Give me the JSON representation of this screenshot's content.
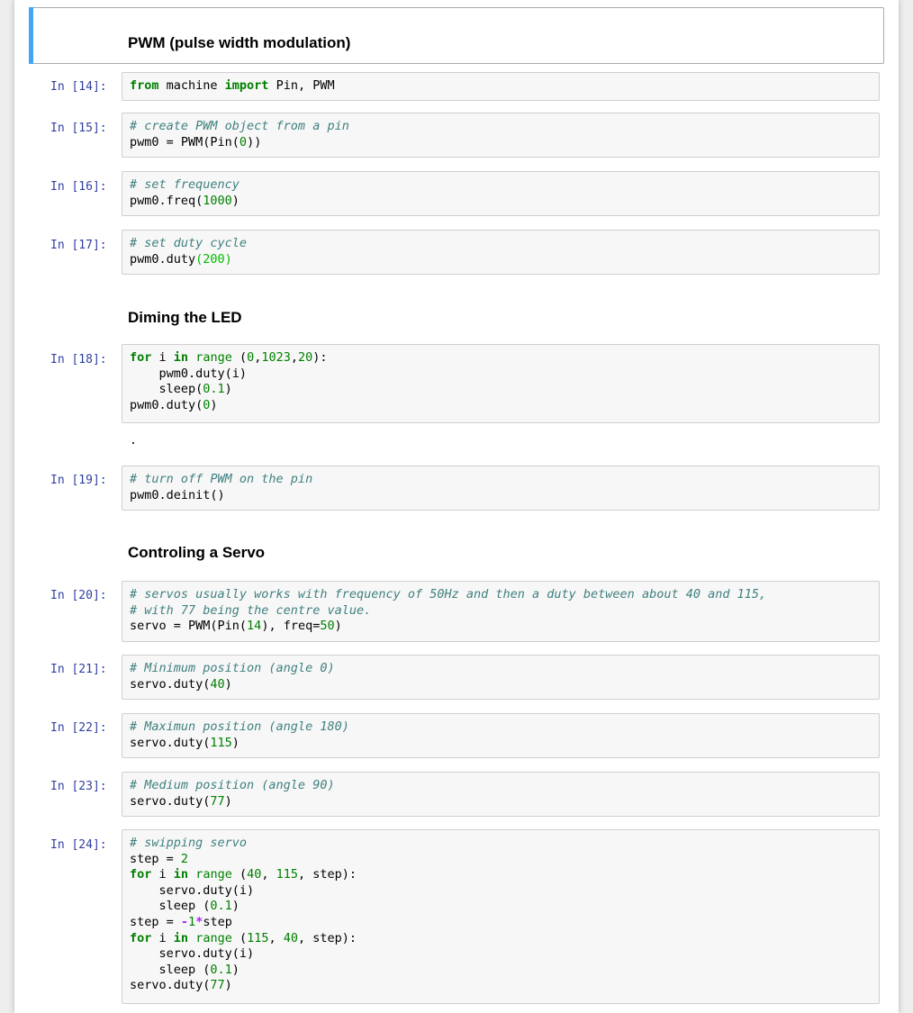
{
  "headings": {
    "pwm": "PWM (pulse width modulation)",
    "dimming": "Diming the LED",
    "servo": "Controling a Servo"
  },
  "output": {
    "cell18": "."
  },
  "cells": [
    {
      "prompt": "In [14]:",
      "lines": [
        [
          {
            "t": "from",
            "c": "kw"
          },
          {
            "t": " machine "
          },
          {
            "t": "import",
            "c": "kw"
          },
          {
            "t": " Pin, PWM"
          }
        ]
      ]
    },
    {
      "prompt": "In [15]:",
      "lines": [
        [
          {
            "t": "# create PWM object from a pin",
            "c": "cm"
          }
        ],
        [
          {
            "t": "pwm0 = PWM(Pin("
          },
          {
            "t": "0",
            "c": "num"
          },
          {
            "t": "))"
          }
        ]
      ]
    },
    {
      "prompt": "In [16]:",
      "lines": [
        [
          {
            "t": "# set frequency",
            "c": "cm"
          }
        ],
        [
          {
            "t": "pwm0.freq("
          },
          {
            "t": "1000",
            "c": "num"
          },
          {
            "t": ")"
          }
        ]
      ]
    },
    {
      "prompt": "In [17]:",
      "lines": [
        [
          {
            "t": "# set duty cycle",
            "c": "cm"
          }
        ],
        [
          {
            "t": "pwm0.duty"
          },
          {
            "t": "(200)",
            "c": "hl"
          }
        ]
      ]
    },
    {
      "prompt": "In [18]:",
      "lines": [
        [
          {
            "t": "for",
            "c": "kw"
          },
          {
            "t": " i "
          },
          {
            "t": "in",
            "c": "kw"
          },
          {
            "t": " "
          },
          {
            "t": "range",
            "c": "bi"
          },
          {
            "t": " ("
          },
          {
            "t": "0",
            "c": "num"
          },
          {
            "t": ","
          },
          {
            "t": "1023",
            "c": "num"
          },
          {
            "t": ","
          },
          {
            "t": "20",
            "c": "num"
          },
          {
            "t": "):"
          }
        ],
        [
          {
            "t": "    pwm0.duty(i)"
          }
        ],
        [
          {
            "t": "    sleep("
          },
          {
            "t": "0.1",
            "c": "num"
          },
          {
            "t": ")"
          }
        ],
        [
          {
            "t": "pwm0.duty("
          },
          {
            "t": "0",
            "c": "num"
          },
          {
            "t": ")"
          }
        ]
      ]
    },
    {
      "prompt": "In [19]:",
      "lines": [
        [
          {
            "t": "# turn off PWM on the pin",
            "c": "cm"
          }
        ],
        [
          {
            "t": "pwm0.deinit()"
          }
        ]
      ]
    },
    {
      "prompt": "In [20]:",
      "lines": [
        [
          {
            "t": "# servos usually works with frequency of 50Hz and then a duty between about 40 and 115,",
            "c": "cm"
          }
        ],
        [
          {
            "t": "# with 77 being the centre value.",
            "c": "cm"
          }
        ],
        [
          {
            "t": "servo = PWM(Pin("
          },
          {
            "t": "14",
            "c": "num"
          },
          {
            "t": "), freq="
          },
          {
            "t": "50",
            "c": "num"
          },
          {
            "t": ")"
          }
        ]
      ]
    },
    {
      "prompt": "In [21]:",
      "lines": [
        [
          {
            "t": "# Minimum position (angle 0)",
            "c": "cm"
          }
        ],
        [
          {
            "t": "servo.duty("
          },
          {
            "t": "40",
            "c": "num"
          },
          {
            "t": ")"
          }
        ]
      ]
    },
    {
      "prompt": "In [22]:",
      "lines": [
        [
          {
            "t": "# Maximun position (angle 180)",
            "c": "cm"
          }
        ],
        [
          {
            "t": "servo.duty("
          },
          {
            "t": "115",
            "c": "num"
          },
          {
            "t": ")"
          }
        ]
      ]
    },
    {
      "prompt": "In [23]:",
      "lines": [
        [
          {
            "t": "# Medium position (angle 90)",
            "c": "cm"
          }
        ],
        [
          {
            "t": "servo.duty("
          },
          {
            "t": "77",
            "c": "num"
          },
          {
            "t": ")"
          }
        ]
      ]
    },
    {
      "prompt": "In [24]:",
      "lines": [
        [
          {
            "t": "# swipping servo",
            "c": "cm"
          }
        ],
        [
          {
            "t": "step = "
          },
          {
            "t": "2",
            "c": "num"
          }
        ],
        [
          {
            "t": "for",
            "c": "kw"
          },
          {
            "t": " i "
          },
          {
            "t": "in",
            "c": "kw"
          },
          {
            "t": " "
          },
          {
            "t": "range",
            "c": "bi"
          },
          {
            "t": " ("
          },
          {
            "t": "40",
            "c": "num"
          },
          {
            "t": ", "
          },
          {
            "t": "115",
            "c": "num"
          },
          {
            "t": ", step):"
          }
        ],
        [
          {
            "t": "    servo.duty(i)"
          }
        ],
        [
          {
            "t": "    sleep ("
          },
          {
            "t": "0.1",
            "c": "num"
          },
          {
            "t": ")"
          }
        ],
        [
          {
            "t": "step = "
          },
          {
            "t": "-",
            "c": "op"
          },
          {
            "t": "1",
            "c": "num"
          },
          {
            "t": "*",
            "c": "op"
          },
          {
            "t": "step"
          }
        ],
        [
          {
            "t": "for",
            "c": "kw"
          },
          {
            "t": " i "
          },
          {
            "t": "in",
            "c": "kw"
          },
          {
            "t": " "
          },
          {
            "t": "range",
            "c": "bi"
          },
          {
            "t": " ("
          },
          {
            "t": "115",
            "c": "num"
          },
          {
            "t": ", "
          },
          {
            "t": "40",
            "c": "num"
          },
          {
            "t": ", step):"
          }
        ],
        [
          {
            "t": "    servo.duty(i)"
          }
        ],
        [
          {
            "t": "    sleep ("
          },
          {
            "t": "0.1",
            "c": "num"
          },
          {
            "t": ")"
          }
        ],
        [
          {
            "t": "servo.duty("
          },
          {
            "t": "77",
            "c": "num"
          },
          {
            "t": ")"
          }
        ]
      ]
    }
  ]
}
